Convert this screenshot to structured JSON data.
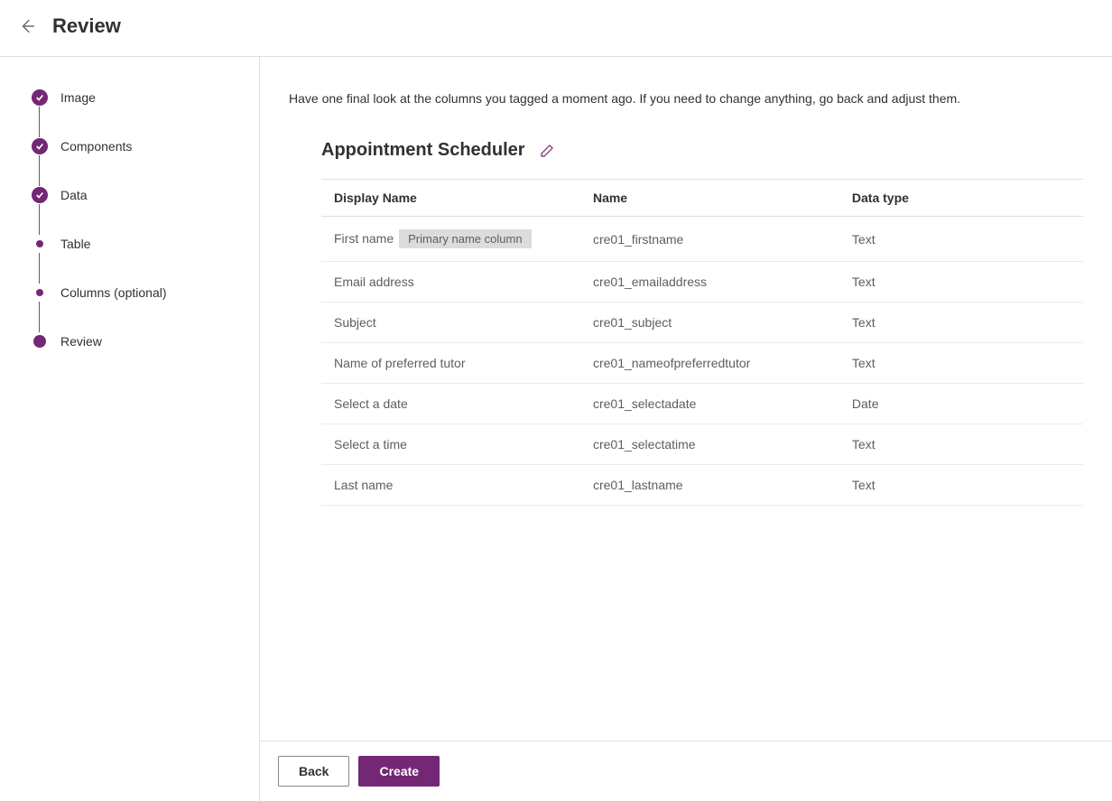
{
  "header": {
    "title": "Review"
  },
  "sidebar": {
    "steps": [
      {
        "label": "Image",
        "state": "checked"
      },
      {
        "label": "Components",
        "state": "checked"
      },
      {
        "label": "Data",
        "state": "checked"
      },
      {
        "label": "Table",
        "state": "small"
      },
      {
        "label": "Columns (optional)",
        "state": "small"
      },
      {
        "label": "Review",
        "state": "current"
      }
    ]
  },
  "content": {
    "intro_text": "Have one final look at the columns you tagged a moment ago. If you need to change anything, go back and adjust them.",
    "table_title": "Appointment Scheduler",
    "columns_header": {
      "display": "Display Name",
      "name": "Name",
      "type": "Data type"
    },
    "primary_badge": "Primary name column",
    "rows": [
      {
        "display": "First name",
        "name": "cre01_firstname",
        "type": "Text",
        "primary": true
      },
      {
        "display": "Email address",
        "name": "cre01_emailaddress",
        "type": "Text",
        "primary": false
      },
      {
        "display": "Subject",
        "name": "cre01_subject",
        "type": "Text",
        "primary": false
      },
      {
        "display": "Name of preferred tutor",
        "name": "cre01_nameofpreferredtutor",
        "type": "Text",
        "primary": false
      },
      {
        "display": "Select a date",
        "name": "cre01_selectadate",
        "type": "Date",
        "primary": false
      },
      {
        "display": "Select a time",
        "name": "cre01_selectatime",
        "type": "Text",
        "primary": false
      },
      {
        "display": "Last name",
        "name": "cre01_lastname",
        "type": "Text",
        "primary": false
      }
    ]
  },
  "footer": {
    "back_label": "Back",
    "create_label": "Create"
  }
}
